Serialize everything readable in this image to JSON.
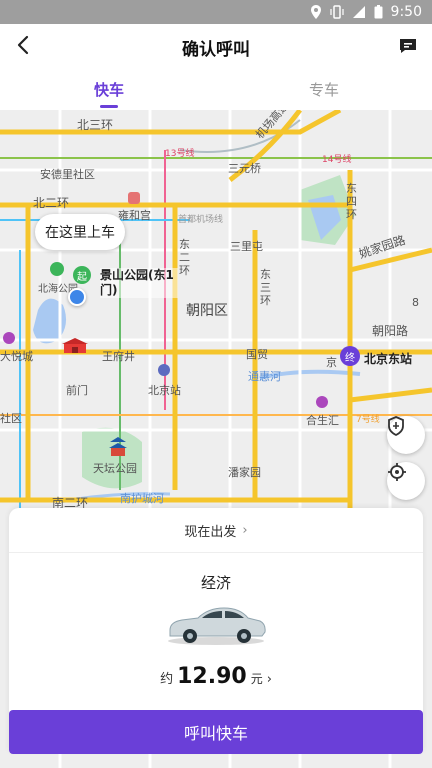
{
  "status_bar": {
    "time": "9:50"
  },
  "header": {
    "title": "确认呼叫"
  },
  "tabs": [
    {
      "label": "快车"
    },
    {
      "label": "专车"
    }
  ],
  "map": {
    "pickup_bubble": "在这里上车",
    "start_marker": "起",
    "end_marker": "终",
    "pickup_poi": "景山公园(东1门)",
    "destination": "北京东站",
    "labels": {
      "beisanhuan": "北三环",
      "airport_expressway": "机场高速",
      "line13": "13号线",
      "line14": "14号线",
      "sanyuanqiao": "三元桥",
      "andeli": "安德里社区",
      "beierhuan": "北二环",
      "yonghegong": "雍和宫",
      "airport_line": "首都机场线",
      "dongsihuan": "东四环",
      "yaojiayuan_rd": "姚家园路",
      "dongerhuan": "东二环",
      "sanlitun": "三里屯",
      "dongsanhuan": "东三环",
      "beihai_park": "北海公园",
      "chaoyang_district": "朝阳区",
      "chaoyang_rd": "朝阳路",
      "xidan": "大悦城",
      "wangfujing": "王府井",
      "guomao": "国贸",
      "tonghuihe": "通惠河",
      "qianmen": "前门",
      "beijing_station": "北京站",
      "heshenghui": "合生汇",
      "shequ": "社区",
      "line7": "7号线",
      "tiantan": "天坛公园",
      "panjiayuan": "潘家园",
      "nanerhuan": "南二环",
      "nanhucheng": "南护城河",
      "jing": "京",
      "b_edge": "8"
    }
  },
  "card": {
    "depart_label": "现在出发",
    "car_type": "经济",
    "price_prefix": "约",
    "price": "12.90",
    "price_unit": "元"
  },
  "call_button": "呼叫快车",
  "colors": {
    "accent": "#6a3fd8",
    "road_major": "#f5c52c",
    "water": "#a9c9f2",
    "green": "#bfe3c4"
  },
  "icons": {
    "back": "chevron-left-icon",
    "message": "message-icon",
    "shield": "shield-icon",
    "locate": "locate-icon"
  }
}
